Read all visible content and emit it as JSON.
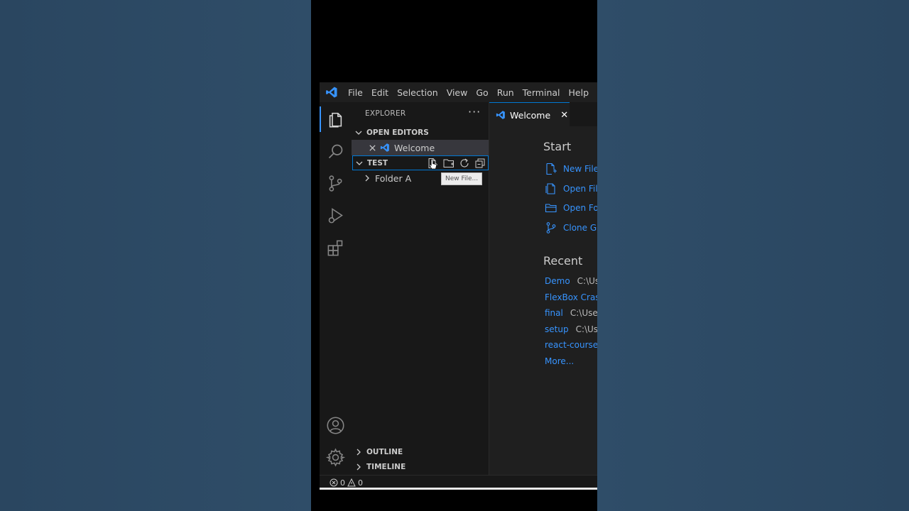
{
  "menu": [
    "File",
    "Edit",
    "Selection",
    "View",
    "Go",
    "Run",
    "Terminal",
    "Help"
  ],
  "sidebar": {
    "title": "EXPLORER",
    "more": "···",
    "open_editors": "OPEN EDITORS",
    "open_editor_item": "Welcome",
    "folder_section": "TEST",
    "folder_item": "Folder A",
    "outline": "OUTLINE",
    "timeline": "TIMELINE",
    "tooltip": "New File..."
  },
  "tab": {
    "label": "Welcome",
    "close": "✕"
  },
  "welcome": {
    "start_heading": "Start",
    "start_items": [
      "New File...",
      "Open File...",
      "Open Folder...",
      "Clone Git Repository..."
    ],
    "recent_heading": "Recent",
    "recent": [
      {
        "name": "Demo",
        "path": "C:\\Us"
      },
      {
        "name": "FlexBox Crash",
        "path": ""
      },
      {
        "name": "final",
        "path": "C:\\User"
      },
      {
        "name": "setup",
        "path": "C:\\Us"
      },
      {
        "name": "react-course-c",
        "path": ""
      }
    ],
    "more": "More..."
  },
  "status": {
    "errors": "0",
    "warnings": "0"
  },
  "colors": {
    "accent": "#0078d4",
    "link": "#3794ff",
    "background": "#1e1e1e"
  }
}
